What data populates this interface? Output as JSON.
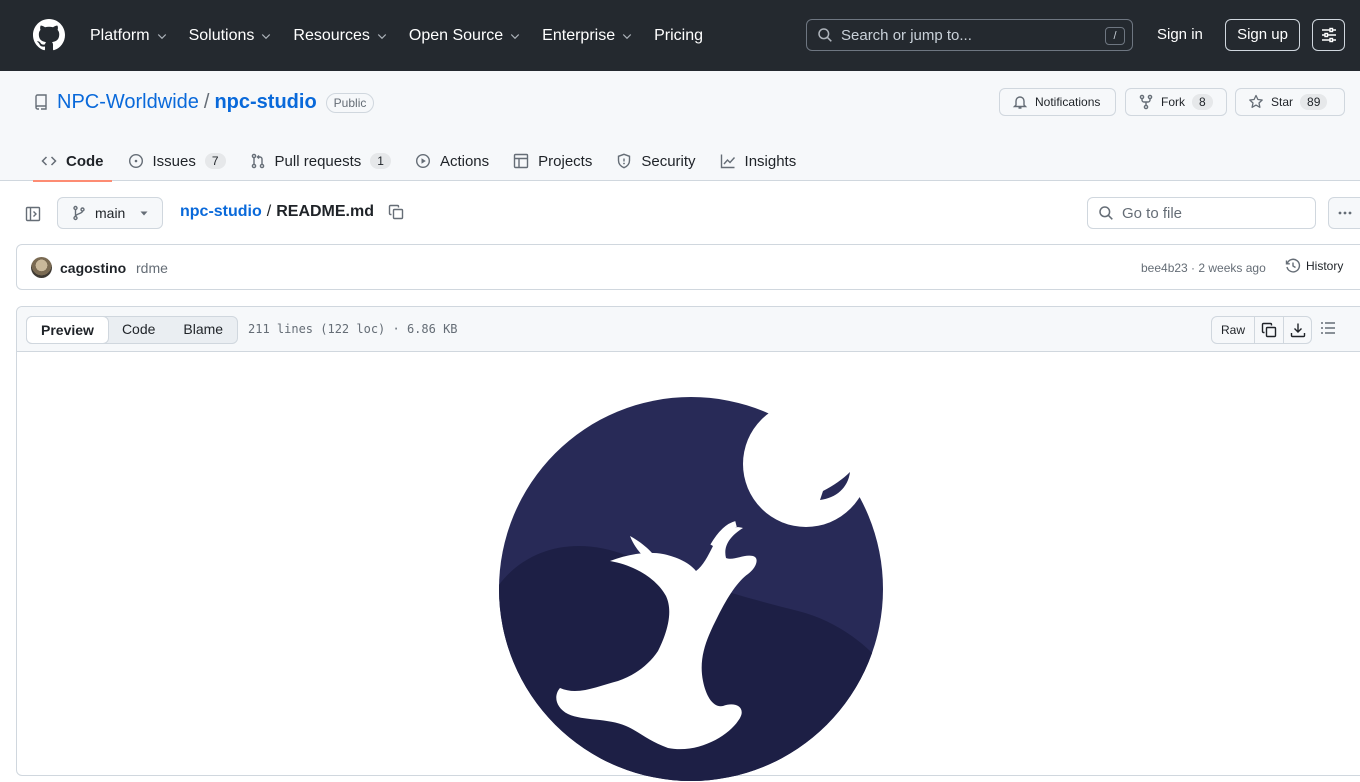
{
  "topnav": {
    "items": [
      {
        "label": "Platform",
        "has_caret": true
      },
      {
        "label": "Solutions",
        "has_caret": true
      },
      {
        "label": "Resources",
        "has_caret": true
      },
      {
        "label": "Open Source",
        "has_caret": true
      },
      {
        "label": "Enterprise",
        "has_caret": true
      },
      {
        "label": "Pricing",
        "has_caret": false
      }
    ],
    "search_placeholder": "Search or jump to...",
    "search_shortcut": "/",
    "sign_in": "Sign in",
    "sign_up": "Sign up"
  },
  "repo": {
    "owner": "NPC-Worldwide",
    "separator": "/",
    "name": "npc-studio",
    "visibility": "Public",
    "notifications_label": "Notifications",
    "fork_label": "Fork",
    "fork_count": "8",
    "star_label": "Star",
    "star_count": "89"
  },
  "tabs": [
    {
      "label": "Code",
      "count": "",
      "active": true,
      "icon": "code-icon"
    },
    {
      "label": "Issues",
      "count": "7",
      "active": false,
      "icon": "issue-icon"
    },
    {
      "label": "Pull requests",
      "count": "1",
      "active": false,
      "icon": "pull-request-icon"
    },
    {
      "label": "Actions",
      "count": "",
      "active": false,
      "icon": "play-icon"
    },
    {
      "label": "Projects",
      "count": "",
      "active": false,
      "icon": "table-icon"
    },
    {
      "label": "Security",
      "count": "",
      "active": false,
      "icon": "shield-icon"
    },
    {
      "label": "Insights",
      "count": "",
      "active": false,
      "icon": "graph-icon"
    }
  ],
  "filenav": {
    "branch": "main",
    "path_repo": "npc-studio",
    "path_sep": "/",
    "path_file": "README.md",
    "goto_placeholder": "Go to file"
  },
  "commit": {
    "author": "cagostino",
    "message": "rdme",
    "hash_time": "bee4b23 · 2 weeks ago",
    "history_label": "History"
  },
  "file": {
    "views": [
      {
        "label": "Preview",
        "active": true
      },
      {
        "label": "Code",
        "active": false
      },
      {
        "label": "Blame",
        "active": false
      }
    ],
    "info": "211 lines (122 loc) · 6.86 KB",
    "raw_label": "Raw"
  },
  "colors": {
    "header_bg": "#24292f",
    "link": "#0969da",
    "tab_underline": "#fd8c73",
    "logo_circle": "#282a57",
    "logo_hill": "#1d1f45",
    "logo_white": "#ffffff"
  }
}
